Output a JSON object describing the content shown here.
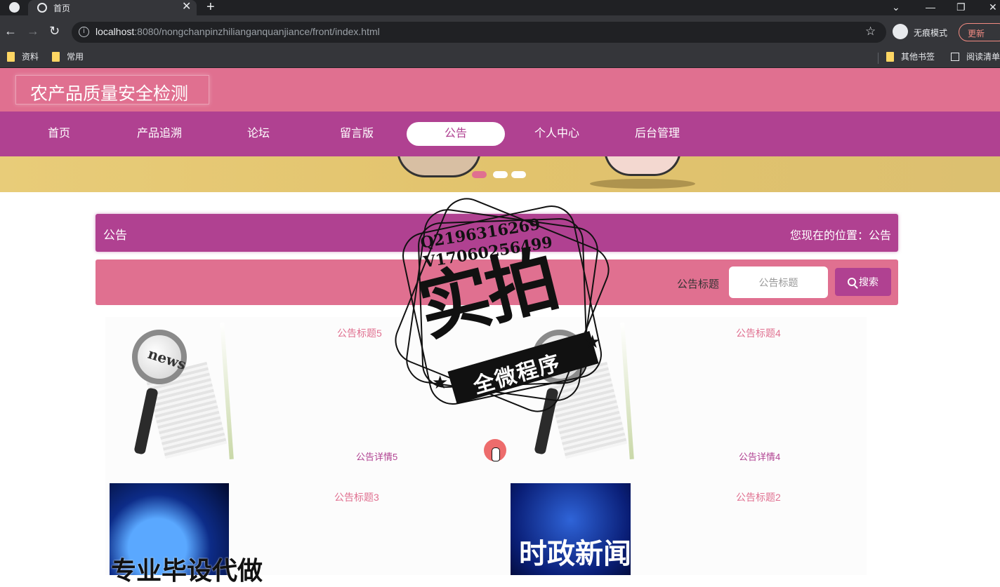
{
  "browser": {
    "tab_title": "首页",
    "url_host": "localhost",
    "url_path": ":8080/nongchanpinzhilianganquanjiance/front/index.html",
    "incognito_label": "无痕模式",
    "update_label": "更新",
    "bookmarks": [
      "资料",
      "常用"
    ],
    "bookmarks_right": [
      "其他书签",
      "阅读清单"
    ]
  },
  "site": {
    "title": "农产品质量安全检测"
  },
  "nav": {
    "items": [
      "首页",
      "产品追溯",
      "论坛",
      "留言版",
      "公告",
      "个人中心",
      "后台管理"
    ],
    "active": "公告"
  },
  "crumb": {
    "title": "公告",
    "location": "您现在的位置：公告"
  },
  "search": {
    "label": "公告标题",
    "placeholder": "公告标题",
    "button": "搜索"
  },
  "cards": [
    {
      "title": "公告标题5",
      "detail": "公告详情5",
      "image": "news-magnifier-image"
    },
    {
      "title": "公告标题4",
      "detail": "公告详情4",
      "image": "news-magnifier-image"
    },
    {
      "title": "公告标题3",
      "detail": "",
      "image": "blue-globe-image",
      "image_text": "专业毕设代做"
    },
    {
      "title": "公告标题2",
      "detail": "",
      "image": "blue-news-image",
      "image_text": "时政新闻"
    }
  ],
  "watermark": {
    "qq": "Q2196316269",
    "vx": "V17060256499",
    "main": "实拍",
    "ribbon": "全微程序"
  },
  "colors": {
    "header_pink": "#e07090",
    "nav_purple": "#b04191"
  }
}
